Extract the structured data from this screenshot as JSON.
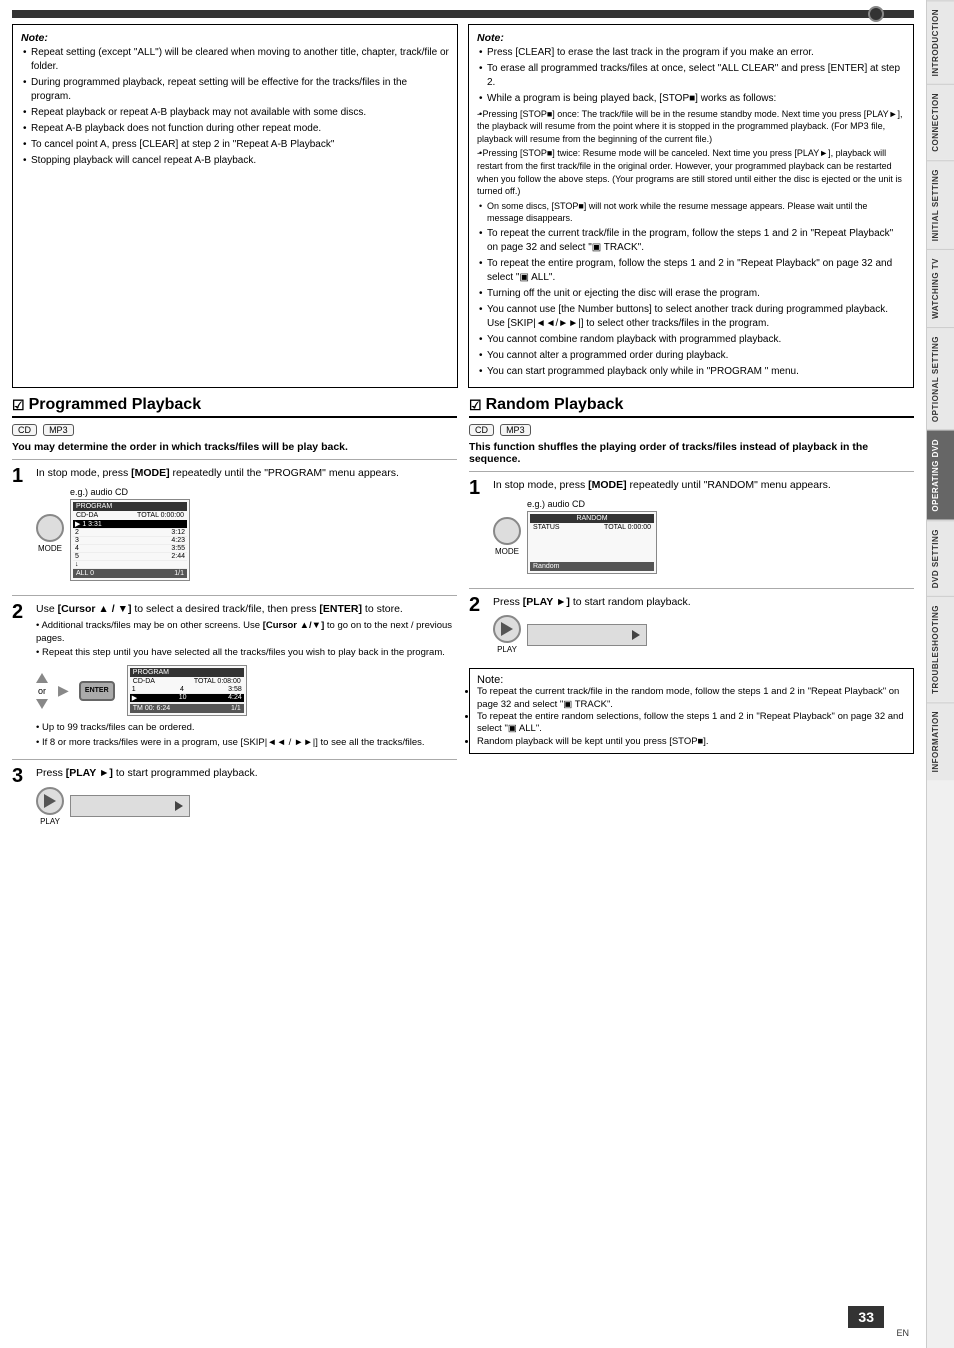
{
  "page": {
    "number": "33",
    "en_label": "EN"
  },
  "tabs": [
    {
      "label": "INTRODUCTION",
      "active": false
    },
    {
      "label": "CONNECTION",
      "active": false
    },
    {
      "label": "INITIAL SETTING",
      "active": false
    },
    {
      "label": "WATCHING TV",
      "active": false
    },
    {
      "label": "OPTIONAL SETTING",
      "active": false
    },
    {
      "label": "OPERATING DVD",
      "active": true
    },
    {
      "label": "DVD SETTING",
      "active": false
    },
    {
      "label": "TROUBLESHOOTING",
      "active": false
    },
    {
      "label": "INFORMATION",
      "active": false
    }
  ],
  "top_note_left": {
    "title": "Note:",
    "items": [
      "Repeat setting (except \"ALL\") will be cleared when moving to another title, chapter, track/file or folder.",
      "During programmed playback, repeat setting will be effective for the tracks/files in the program.",
      "Repeat playback or repeat A-B playback may not available with some discs.",
      "Repeat A-B playback does not function during other repeat mode.",
      "To cancel point A, press [CLEAR] at step 2 in \"Repeat A-B Playback\"",
      "Stopping playback will cancel repeat A-B playback."
    ]
  },
  "top_note_right": {
    "title": "Note:",
    "items": [
      "Press [CLEAR] to erase the last track in the program if you make an error.",
      "To erase all programmed tracks/files at once, select \"ALL CLEAR\" and press [ENTER] at step 2.",
      "While a program is being played back, [STOP■] works as follows:",
      "- Pressing [STOP■] once: The track/file will be in the resume standby mode. Next time you press [PLAY►], the playback will resume from the point where it is stopped in the programmed playback. (For MP3 file, playback will resume from the beginning of the current file.)",
      "- Pressing [STOP■] twice: Resume mode will be canceled. Next time you press [PLAY►], playback will restart from the first track/file in the original order. However, your programmed playback can be restarted when you follow the above steps. (Your programs are still stored until either the disc is ejected or the unit is turned off.)",
      "On some discs, [STOP■] will not work while the resume message appears. Please wait until the message disappears.",
      "To repeat the current track/file in the program, follow the steps 1 and 2 in \"Repeat Playback\" on page 32 and select \"▣ TRACK\".",
      "To repeat the entire program, follow the steps 1 and 2 in \"Repeat Playback\" on page 32 and select \"▣ ALL\".",
      "Turning off the unit or ejecting the disc will erase the program.",
      "You cannot use [the Number buttons] to select another track during programmed playback. Use [SKIP|◄◄/►►|] to select other tracks/files in the program.",
      "You cannot combine random playback with programmed playback.",
      "You cannot alter a programmed order during playback.",
      "You can start programmed playback only while in \"PROGRAM \" menu."
    ]
  },
  "programmed_playback": {
    "title": "Programmed Playback",
    "checkmark": "☑",
    "badges": [
      "CD",
      "MP3"
    ],
    "subtitle": "You may determine the order in which tracks/files will be play back.",
    "step1": {
      "number": "1",
      "text": "In stop mode, press [MODE] repeatedly until the \"PROGRAM\" menu appears.",
      "eg_label": "e.g.) audio CD",
      "mode_label": "MODE"
    },
    "step2": {
      "number": "2",
      "text": "Use [Cursor ▲ / ▼] to select a desired track/file, then press [ENTER] to store.",
      "sub_notes": [
        "Additional tracks/files may be on other screens. Use [Cursor ▲/▼] to go on to the next / previous pages.",
        "Repeat this step until you have selected all the tracks/files you wish to play back in the program."
      ],
      "note1": "Up to 99 tracks/files can be ordered.",
      "note2": "If 8 or more tracks/files were in a program, use [SKIP|◄◄ / ►►|] to see all the tracks/files.",
      "or_label": "or",
      "enter_label": "ENTER"
    },
    "step3": {
      "number": "3",
      "text": "Press [PLAY ►] to start programmed playback.",
      "play_label": "PLAY"
    }
  },
  "random_playback": {
    "title": "Random Playback",
    "checkmark": "☑",
    "badges": [
      "CD",
      "MP3"
    ],
    "subtitle": "This function shuffles the playing order of tracks/files instead of playback in the sequence.",
    "step1": {
      "number": "1",
      "text": "In stop mode, press [MODE] repeatedly until \"RANDOM\" menu appears.",
      "eg_label": "e.g.) audio CD",
      "mode_label": "MODE"
    },
    "step2": {
      "number": "2",
      "text": "Press [PLAY ►] to start random playback.",
      "play_label": "PLAY"
    },
    "note": {
      "title": "Note:",
      "items": [
        "To repeat the current track/file in the random mode, follow the steps 1 and 2 in \"Repeat Playback\" on page 32 and select \"▣ TRACK\".",
        "To repeat the entire random selections, follow the steps 1 and 2 in \"Repeat Playback\" on page 32 and select \"▣ ALL\".",
        "Random playback will be kept until you press [STOP■]."
      ]
    }
  }
}
